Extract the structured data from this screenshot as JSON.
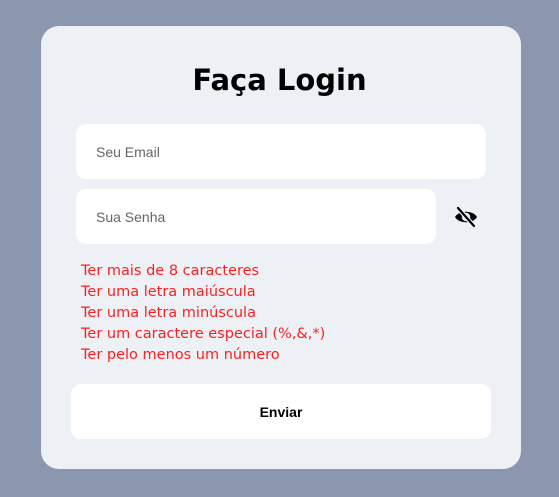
{
  "colors": {
    "page_background": "#8b97ae",
    "card_background": "#edf0f4",
    "error_text": "#ff1f1f"
  },
  "form": {
    "title": "Faça Login",
    "email": {
      "placeholder": "Seu Email",
      "value": ""
    },
    "password": {
      "placeholder": "Sua Senha",
      "value": "",
      "toggle_icon": "eye-slash-icon"
    },
    "password_rules": [
      "Ter mais de 8 caracteres",
      "Ter uma letra maiúscula",
      "Ter uma letra minúscula",
      "Ter um caractere especial (%,&,*)",
      "Ter pelo menos um número"
    ],
    "submit_label": "Enviar"
  }
}
